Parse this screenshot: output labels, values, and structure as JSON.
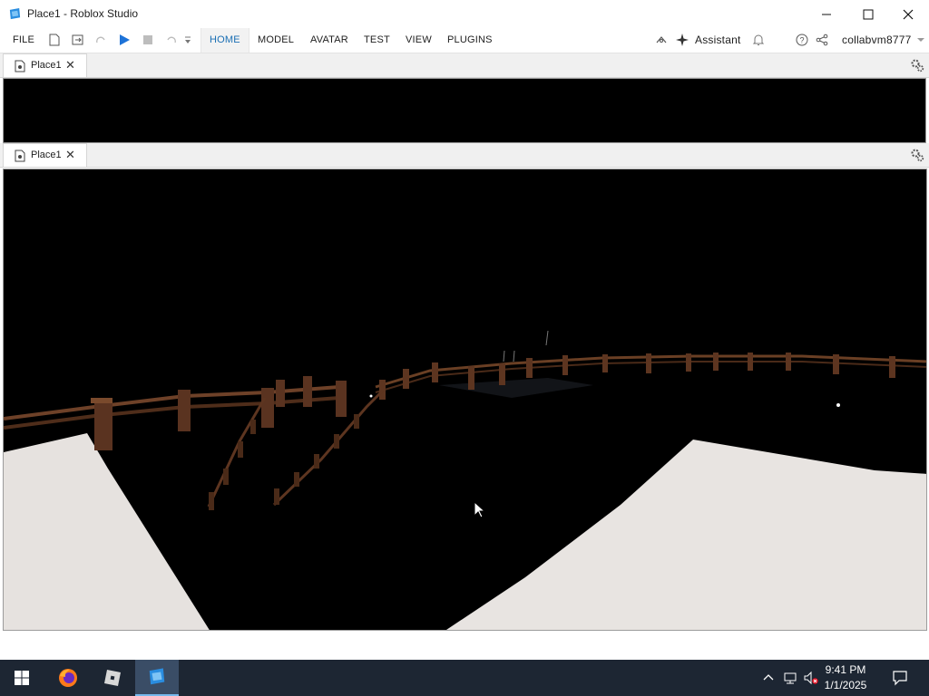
{
  "window": {
    "title": "Place1 - Roblox Studio"
  },
  "menu": {
    "file": "FILE",
    "tabs": [
      "HOME",
      "MODEL",
      "AVATAR",
      "TEST",
      "VIEW",
      "PLUGINS"
    ],
    "assistant": "Assistant",
    "username": "collabvm8777"
  },
  "doc_tabs": [
    {
      "label": "Place1",
      "close": "✕"
    },
    {
      "label": "Place1",
      "close": "✕"
    }
  ],
  "taskbar": {
    "time": "9:41 PM",
    "date": "1/1/2025"
  },
  "colors": {
    "accent": "#1a6fb4",
    "play": "#1e73d8",
    "taskbar": "#1d2633",
    "snow": "#e8e4e1",
    "fence": "#5a3320"
  }
}
